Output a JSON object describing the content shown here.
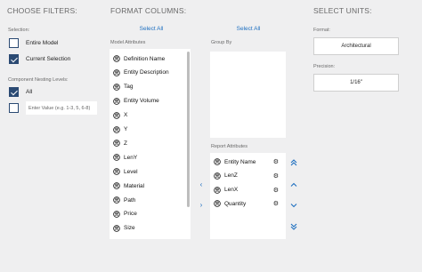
{
  "filters": {
    "title": "CHOOSE FILTERS:",
    "selection_label": "Selection:",
    "options": [
      {
        "label": "Entire Model",
        "checked": false
      },
      {
        "label": "Current Selection",
        "checked": true
      }
    ],
    "nesting_label": "Component Nesting Levels:",
    "nesting_all": {
      "label": "All",
      "checked": true
    },
    "nesting_input_placeholder": "Enter Value (e.g. 1-3, 5, 6-8)"
  },
  "format": {
    "title": "FORMAT COLUMNS:",
    "select_all_left": "Select All",
    "select_all_right": "Select All",
    "model_attributes_label": "Model Attributes",
    "group_by_label": "Group By",
    "report_attributes_label": "Report Attributes",
    "model_attributes": [
      "Definition Name",
      "Entity Description",
      "Tag",
      "Entity Volume",
      "X",
      "Y",
      "Z",
      "LenY",
      "Level",
      "Material",
      "Path",
      "Price",
      "Size"
    ],
    "report_attributes": [
      "Entity Name",
      "LenZ",
      "LenX",
      "Quantity"
    ],
    "icons": {
      "attribute": "attribute-icon",
      "gear": "gear-icon",
      "move_left": "chevron-left-icon",
      "move_right": "chevron-right-icon",
      "move_top": "double-chevron-up-icon",
      "move_up": "chevron-up-icon",
      "move_down": "chevron-down-icon",
      "move_bottom": "double-chevron-down-icon"
    }
  },
  "units": {
    "title": "SELECT UNITS:",
    "format_label": "Format:",
    "format_value": "Architectural",
    "precision_label": "Precision:",
    "precision_value": "1/16\""
  },
  "colors": {
    "accent": "#2b4a73",
    "link": "#1e6fc0",
    "background": "#efeff0"
  }
}
